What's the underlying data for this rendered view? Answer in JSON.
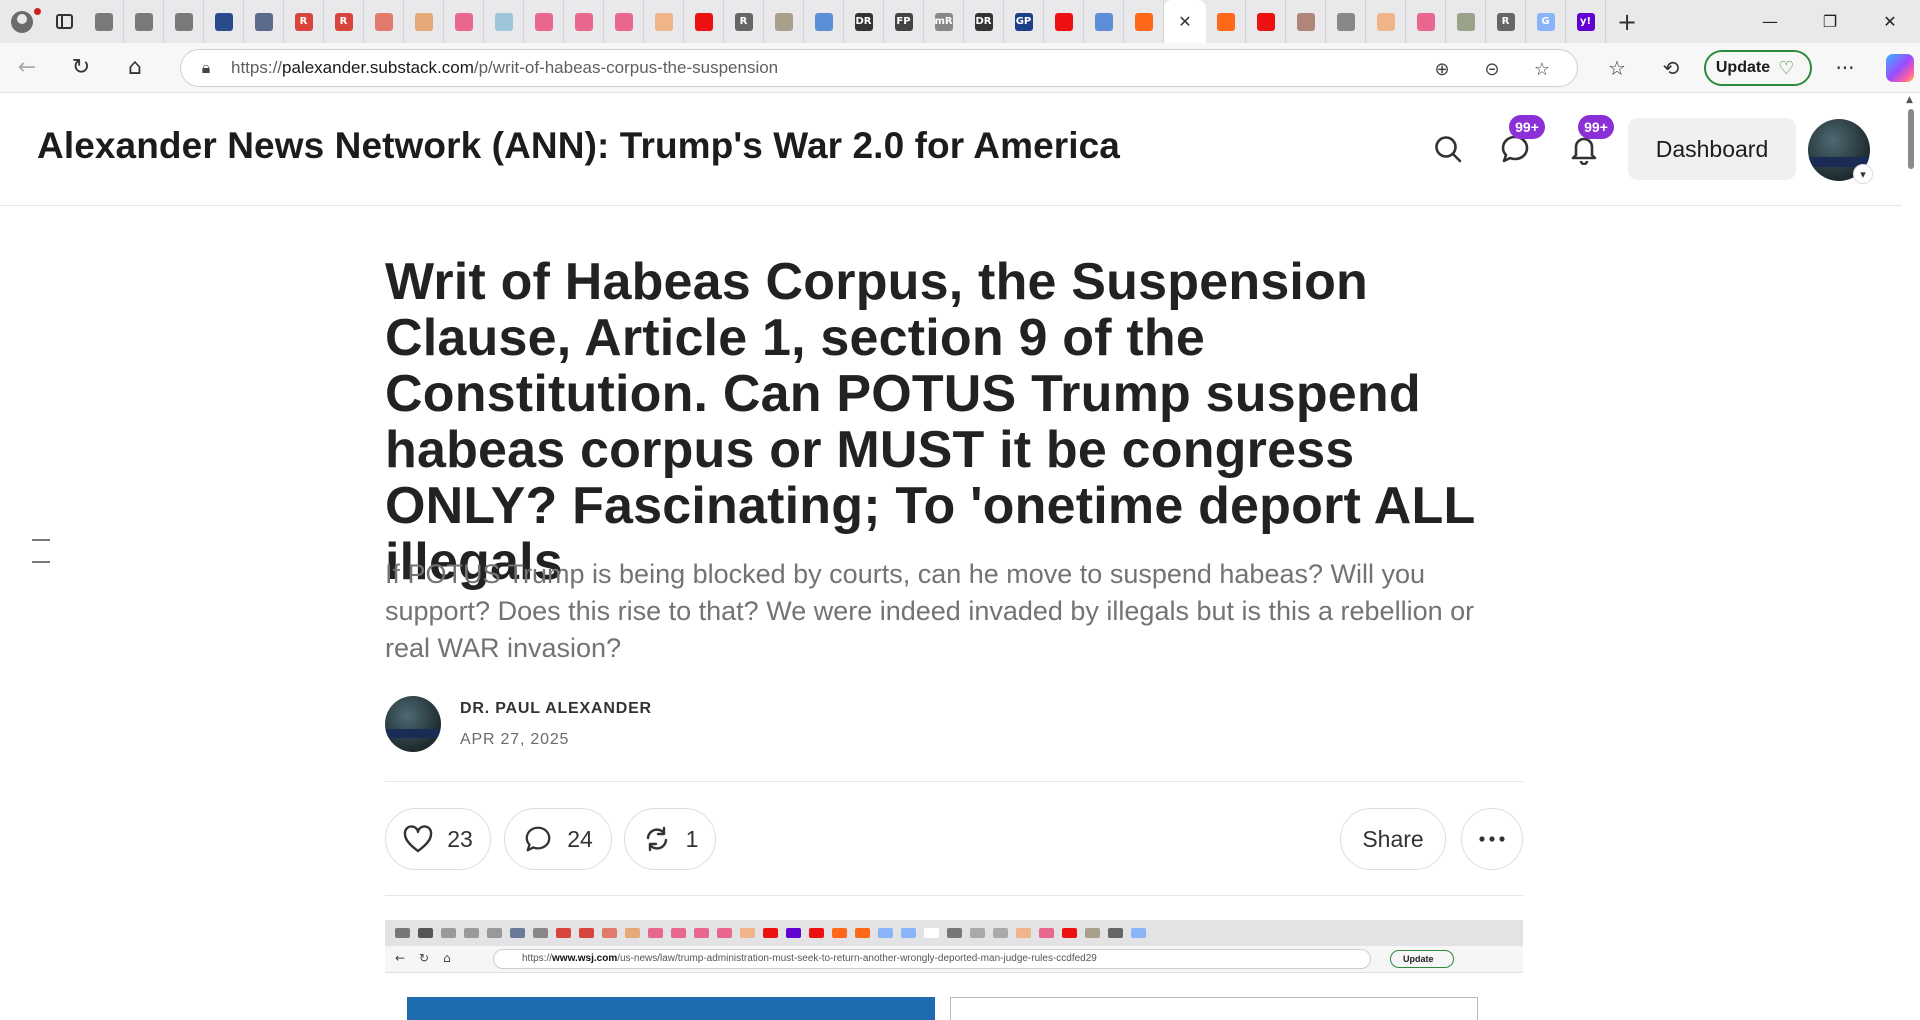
{
  "browser": {
    "tabs": [
      {
        "icon": "globe-icon",
        "color": "#7a7a7a"
      },
      {
        "icon": "globe-icon",
        "color": "#7a7a7a"
      },
      {
        "icon": "globe-icon",
        "color": "#7a7a7a"
      },
      {
        "icon": "news-icon",
        "color": "#2b4a8b"
      },
      {
        "icon": "doc-icon",
        "color": "#5a6b8c"
      },
      {
        "icon": "r-logo-icon",
        "color": "#d8453d",
        "text": "R"
      },
      {
        "icon": "r-logo-icon",
        "color": "#d8453d",
        "text": "R"
      },
      {
        "icon": "pdf-icon",
        "color": "#e07a6b"
      },
      {
        "icon": "circle-icon",
        "color": "#e6a877"
      },
      {
        "icon": "video-icon",
        "color": "#e9678f"
      },
      {
        "icon": "leaf-icon",
        "color": "#9ec4d8"
      },
      {
        "icon": "video-icon",
        "color": "#e9678f"
      },
      {
        "icon": "video-icon",
        "color": "#e9678f"
      },
      {
        "icon": "video-icon",
        "color": "#e9678f"
      },
      {
        "icon": "b-logo-icon",
        "color": "#f0b48a"
      },
      {
        "icon": "youtube-icon",
        "color": "#e11"
      },
      {
        "icon": "r-logo-icon",
        "color": "#666",
        "text": "R"
      },
      {
        "icon": "photo-icon",
        "color": "#a8a08a"
      },
      {
        "icon": "search-icon",
        "color": "#5c8ed8"
      },
      {
        "icon": "dr-icon",
        "color": "#333",
        "text": "DR"
      },
      {
        "icon": "fp-icon",
        "color": "#444",
        "text": "FP"
      },
      {
        "icon": "mr-icon",
        "color": "#888",
        "text": "mR"
      },
      {
        "icon": "dr-icon",
        "color": "#333",
        "text": "DR"
      },
      {
        "icon": "gp-icon",
        "color": "#1c3f8a",
        "text": "GP"
      },
      {
        "icon": "youtube-icon",
        "color": "#e11"
      },
      {
        "icon": "search-icon",
        "color": "#5c8ed8"
      },
      {
        "icon": "substack-icon",
        "color": "#ff6719"
      },
      {
        "icon": "close-icon",
        "color": "#333",
        "text": "✕",
        "active": true
      },
      {
        "icon": "substack-icon",
        "color": "#ff6719"
      },
      {
        "icon": "youtube-icon",
        "color": "#e11"
      },
      {
        "icon": "photo-icon",
        "color": "#b0867a"
      },
      {
        "icon": "chart-icon",
        "color": "#888"
      },
      {
        "icon": "b-logo-icon",
        "color": "#f0b48a"
      },
      {
        "icon": "video-icon",
        "color": "#e9678f"
      },
      {
        "icon": "photo-icon",
        "color": "#9aa38a"
      },
      {
        "icon": "r-logo-icon",
        "color": "#666",
        "text": "R"
      },
      {
        "icon": "google-icon",
        "color": "#8ab4f8",
        "text": "G"
      },
      {
        "icon": "yahoo-icon",
        "color": "#6001d2",
        "text": "y!"
      }
    ],
    "new_tab": "+",
    "window": {
      "minimize": "—",
      "restore": "❐",
      "close": "✕"
    },
    "url_prefix": "https://",
    "url_domain": "palexander.substack.com",
    "url_path": "/p/writ-of-habeas-corpus-the-suspension",
    "update_label": "Update"
  },
  "site": {
    "title": "Alexander News Network (ANN): Trump's War 2.0 for America",
    "messages_badge": "99+",
    "notifications_badge": "99+",
    "dashboard_label": "Dashboard"
  },
  "post": {
    "title": "Writ of Habeas Corpus, the Suspension Clause, Article 1, section 9 of the Constitution. Can POTUS Trump suspend habeas corpus or MUST it be congress ONLY? Fascinating; To 'onetime deport ALL illegals",
    "subtitle": "If POTUS Trump is being blocked by courts, can he move to suspend habeas? Will you support? Does this rise to that? We were indeed invaded by illegals but is this a rebellion or real WAR invasion?",
    "author": "DR. PAUL ALEXANDER",
    "date": "APR 27, 2025",
    "likes": "23",
    "comments": "24",
    "restacks": "1",
    "share_label": "Share"
  },
  "embedded_image": {
    "url_prefix": "https://",
    "url_domain": "www.wsj.com",
    "url_path": "/us-news/law/trump-administration-must-seek-to-return-another-wrongly-deported-man-judge-rules-ccdfed29",
    "update_label": "Update"
  },
  "colors": {
    "badge": "#8b2fd6",
    "update_border": "#2f8a3e",
    "substack_orange": "#ff6719"
  }
}
